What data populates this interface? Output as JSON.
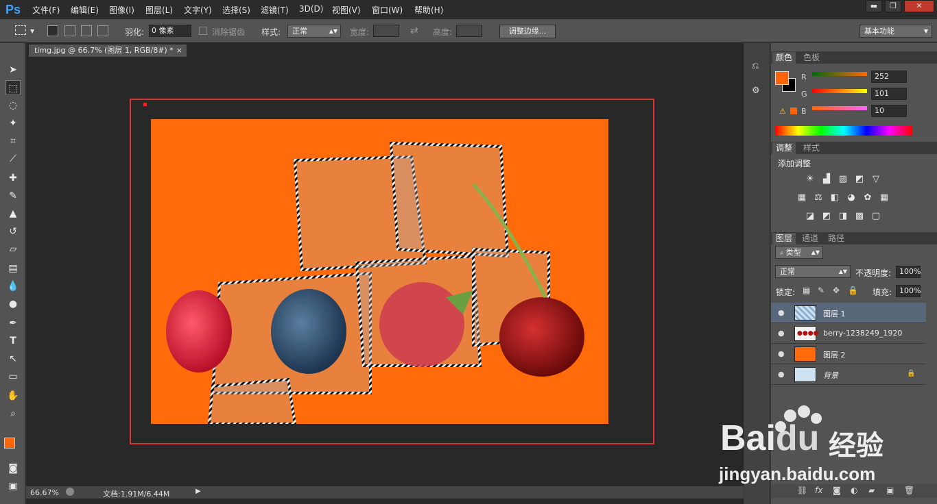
{
  "app": {
    "logo": "Ps",
    "menu": [
      "文件(F)",
      "编辑(E)",
      "图像(I)",
      "图层(L)",
      "文字(Y)",
      "选择(S)",
      "滤镜(T)",
      "3D(D)",
      "视图(V)",
      "窗口(W)",
      "帮助(H)"
    ],
    "window_controls": {
      "minimize": "▬",
      "restore": "❐",
      "close": "✕"
    }
  },
  "options": {
    "feather_label": "羽化:",
    "feather_value": "0 像素",
    "antialias_label": "消除锯齿",
    "style_label": "样式:",
    "style_value": "正常",
    "width_label": "宽度:",
    "height_label": "高度:",
    "refine_edge_button": "调整边缘...",
    "workspace_value": "基本功能"
  },
  "document": {
    "tab_title": "timg.jpg @ 66.7% (图层 1, RGB/8#) *",
    "tab_close": "×",
    "zoom": "66.67%",
    "doc_info": "文档:1.91M/6.44M"
  },
  "color_panel": {
    "tabs": [
      "颜色",
      "色板"
    ],
    "r_label": "R",
    "g_label": "G",
    "b_label": "B",
    "r": "252",
    "g": "101",
    "b": "10",
    "foreground": "#fc650a",
    "background": "#000000"
  },
  "adjust_panel": {
    "tabs": [
      "调整",
      "样式"
    ],
    "title": "添加调整"
  },
  "layers_panel": {
    "tabs": [
      "图层",
      "通道",
      "路径"
    ],
    "filter_kind": "类型",
    "blend_mode": "正常",
    "opacity_label": "不透明度:",
    "opacity": "100%",
    "lock_label": "锁定:",
    "fill_label": "填充:",
    "fill": "100%",
    "layers": [
      {
        "name": "图层 1",
        "selected": true
      },
      {
        "name": "berry-1238249_1920",
        "selected": false
      },
      {
        "name": "图层 2",
        "selected": false
      },
      {
        "name": "背景",
        "selected": false
      }
    ]
  },
  "watermark": {
    "brand": "Bai",
    "brand2": "du",
    "cn": "经验",
    "url": "jingyan.baidu.com"
  },
  "colors": {
    "canvas_orange": "#ff6a0a",
    "selection_box": "#e03434",
    "accent_blue": "#3fa3ff"
  }
}
